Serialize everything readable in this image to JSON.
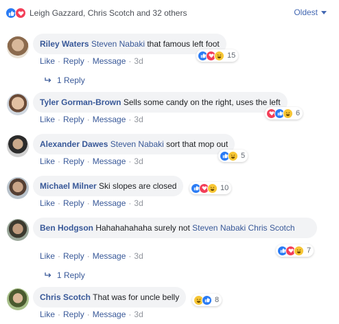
{
  "header": {
    "reactors_text": "Leigh Gazzard, Chris Scotch and 32 others",
    "sort_label": "Oldest"
  },
  "actions": {
    "like": "Like",
    "reply": "Reply",
    "message": "Message"
  },
  "colors": {
    "link": "#385898",
    "like": "#2a7bf4",
    "love": "#f33e58",
    "haha": "#f7c634",
    "bubble": "#f2f3f5"
  },
  "comments": [
    {
      "name": "Riley Waters",
      "tag": "Steven Nabaki",
      "text": "that famous left foot",
      "time": "3d",
      "reactions": [
        "like-icon",
        "love-icon",
        "haha-icon"
      ],
      "count": "15",
      "reply_count": "1 Reply"
    },
    {
      "name": "Tyler Gorman-Brown",
      "tag": "",
      "text": "Sells some candy on the right, uses the left",
      "time": "3d",
      "reactions": [
        "love-icon",
        "like-icon",
        "haha-icon"
      ],
      "count": "6"
    },
    {
      "name": "Alexander Dawes",
      "tag": "Steven Nabaki",
      "text": "sort that mop out",
      "time": "3d",
      "reactions": [
        "like-icon",
        "haha-icon"
      ],
      "count": "5"
    },
    {
      "name": "Michael Milner",
      "tag": "",
      "text": "Ski slopes are closed",
      "time": "3d",
      "reactions": [
        "like-icon",
        "love-icon",
        "haha-icon"
      ],
      "count": "10"
    },
    {
      "name": "Ben Hodgson",
      "tag": "",
      "text": "Hahahahahaha surely not",
      "tag2": "Steven Nabaki Chris Scotch",
      "time": "3d",
      "reactions": [
        "like-icon",
        "love-icon",
        "haha-icon"
      ],
      "count": "7",
      "reply_count": "1 Reply"
    },
    {
      "name": "Chris Scotch",
      "tag": "",
      "text": "That was for uncle belly",
      "time": "3d",
      "reactions": [
        "haha-icon",
        "like-icon"
      ],
      "count": "8"
    }
  ]
}
